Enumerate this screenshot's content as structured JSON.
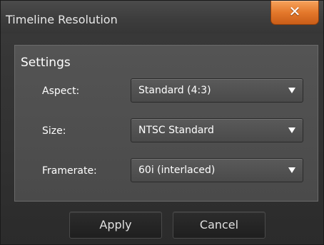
{
  "window": {
    "title": "Timeline Resolution",
    "close_icon": "close-icon"
  },
  "settings": {
    "heading": "Settings",
    "rows": [
      {
        "label": "Aspect:",
        "value": "Standard (4:3)"
      },
      {
        "label": "Size:",
        "value": "NTSC Standard"
      },
      {
        "label": "Framerate:",
        "value": "60i (interlaced)"
      }
    ]
  },
  "buttons": {
    "apply_label": "Apply",
    "cancel_label": "Cancel"
  },
  "colors": {
    "accent": "#e4782b",
    "background": "#2b2b2b",
    "panel": "#4e4e4e"
  }
}
